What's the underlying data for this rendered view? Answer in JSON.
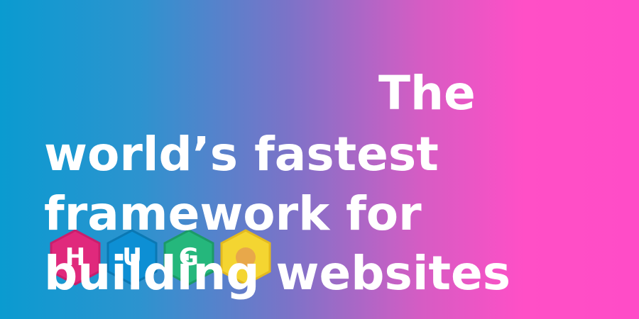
{
  "banner": {
    "gradient_colors": [
      "#0a9bd0",
      "#7b73c8",
      "#ff4fc6"
    ],
    "logo": {
      "letters": [
        "H",
        "U",
        "G",
        "O"
      ],
      "colors": [
        "#e0297c",
        "#0d8fd4",
        "#25b77c",
        "#f4d531"
      ]
    },
    "headline": {
      "lines": [
        "The",
        "world’s fastest",
        "framework for",
        "building websites"
      ]
    }
  }
}
